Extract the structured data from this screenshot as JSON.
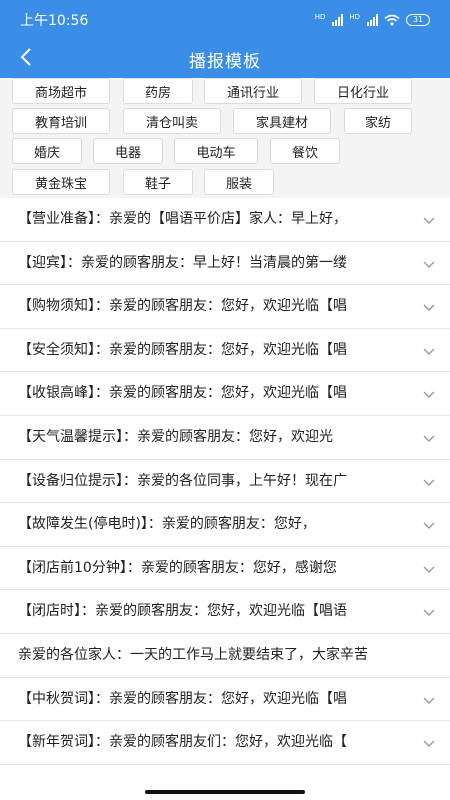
{
  "status_bar": {
    "time": "上午10:56",
    "signal_tag": "HD",
    "battery": "31"
  },
  "nav": {
    "title": "播报模板"
  },
  "categories": [
    "商场超市",
    "药房",
    "通讯行业",
    "日化行业",
    "教育培训",
    "清仓叫卖",
    "家具建材",
    "家纺",
    "婚庆",
    "电器",
    "电动车",
    "餐饮",
    "黄金珠宝",
    "鞋子",
    "服装"
  ],
  "templates": [
    "【营业准备】：亲爱的【唱语平价店】家人：早上好，",
    "【迎宾】：亲爱的顾客朋友：早上好！当清晨的第一缕",
    "【购物须知】：亲爱的顾客朋友：您好，欢迎光临【唱",
    "【安全须知】：亲爱的顾客朋友：您好，欢迎光临【唱",
    "【收银高峰】：亲爱的顾客朋友：您好，欢迎光临【唱",
    "【天气温馨提示】：亲爱的顾客朋友：您好，欢迎光",
    "【设备归位提示】：亲爱的各位同事，上午好！现在广",
    "【故障发生(停电时)】：亲爱的顾客朋友：您好，",
    "【闭店前10分钟】：亲爱的顾客朋友：您好，感谢您",
    "【闭店时】：亲爱的顾客朋友：您好，欢迎光临【唱语",
    "亲爱的各位家人：一天的工作马上就要结束了，大家辛苦",
    "【中秋贺词】：亲爱的顾客朋友：您好，欢迎光临【唱",
    "【新年贺词】：亲爱的顾客朋友们：您好，欢迎光临【"
  ],
  "icons": {
    "back": "chevron-left-icon",
    "expand": "chevron-down-icon"
  },
  "colors": {
    "header": "#3a8ee8",
    "tag_area": "#f4f4f4"
  }
}
